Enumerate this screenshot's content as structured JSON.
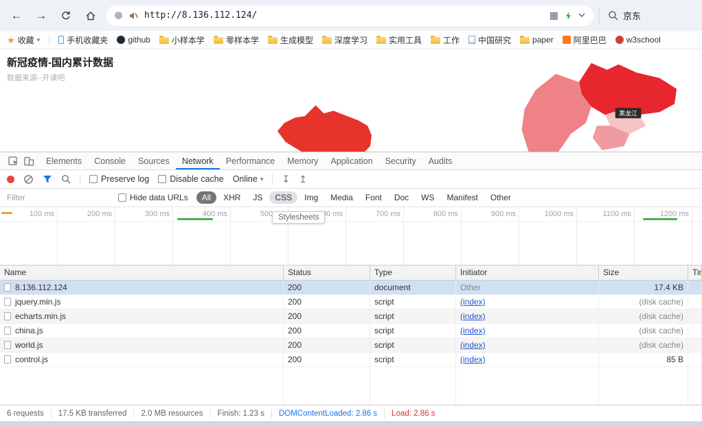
{
  "icons": {
    "back": "←",
    "forward": "→",
    "grid": "▦",
    "star": "★",
    "caret_down": "▾",
    "har_import": "↧",
    "har_export": "↥"
  },
  "browser": {
    "url": "http://8.136.112.124/",
    "search_text": "京东",
    "bookmarks": [
      {
        "label": "收藏"
      },
      {
        "label": "手机收藏夹"
      },
      {
        "label": "github"
      },
      {
        "label": "小样本学"
      },
      {
        "label": "零样本学"
      },
      {
        "label": "生成模型"
      },
      {
        "label": "深度学习"
      },
      {
        "label": "实用工具"
      },
      {
        "label": "工作"
      },
      {
        "label": "中国研究"
      },
      {
        "label": "paper"
      },
      {
        "label": "阿里巴巴"
      },
      {
        "label": "w3school"
      }
    ]
  },
  "page": {
    "title": "新冠疫情-国内累计数据",
    "subtitle": "数据来源--开课吧",
    "map_label": "黑龙江"
  },
  "devtools": {
    "tabs": [
      {
        "label": "Elements"
      },
      {
        "label": "Console"
      },
      {
        "label": "Sources"
      },
      {
        "label": "Network"
      },
      {
        "label": "Performance"
      },
      {
        "label": "Memory"
      },
      {
        "label": "Application"
      },
      {
        "label": "Security"
      },
      {
        "label": "Audits"
      }
    ],
    "toolbar": {
      "preserve_log": "Preserve log",
      "disable_cache": "Disable cache",
      "throttling": "Online"
    },
    "filter": {
      "placeholder": "Filter",
      "hide_data_urls": "Hide data URLs",
      "pills": [
        {
          "label": "All"
        },
        {
          "label": "XHR"
        },
        {
          "label": "JS"
        },
        {
          "label": "CSS"
        },
        {
          "label": "Img"
        },
        {
          "label": "Media"
        },
        {
          "label": "Font"
        },
        {
          "label": "Doc"
        },
        {
          "label": "WS"
        },
        {
          "label": "Manifest"
        },
        {
          "label": "Other"
        }
      ],
      "tooltip": "Stylesheets"
    },
    "timeline": {
      "ticks": [
        {
          "label": "100 ms"
        },
        {
          "label": "200 ms"
        },
        {
          "label": "300 ms"
        },
        {
          "label": "400 ms"
        },
        {
          "label": "500 ms"
        },
        {
          "label": "600 ms"
        },
        {
          "label": "700 ms"
        },
        {
          "label": "800 ms"
        },
        {
          "label": "900 ms"
        },
        {
          "label": "1000 ms"
        },
        {
          "label": "1100 ms"
        },
        {
          "label": "1200 ms"
        }
      ]
    },
    "table": {
      "columns": [
        {
          "label": "Name"
        },
        {
          "label": "Status"
        },
        {
          "label": "Type"
        },
        {
          "label": "Initiator"
        },
        {
          "label": "Size"
        },
        {
          "label": "Time"
        }
      ],
      "rows": [
        {
          "name": "8.136.112.124",
          "status": "200",
          "type": "document",
          "initiator": "Other",
          "size": "17.4 KB"
        },
        {
          "name": "jquery.min.js",
          "status": "200",
          "type": "script",
          "initiator": "(index)",
          "size": "(disk cache)"
        },
        {
          "name": "echarts.min.js",
          "status": "200",
          "type": "script",
          "initiator": "(index)",
          "size": "(disk cache)"
        },
        {
          "name": "china.js",
          "status": "200",
          "type": "script",
          "initiator": "(index)",
          "size": "(disk cache)"
        },
        {
          "name": "world.js",
          "status": "200",
          "type": "script",
          "initiator": "(index)",
          "size": "(disk cache)"
        },
        {
          "name": "control.js",
          "status": "200",
          "type": "script",
          "initiator": "(index)",
          "size": "85 B"
        }
      ]
    },
    "statusbar": {
      "requests": "6 requests",
      "transferred": "17.5 KB transferred",
      "resources": "2.0 MB resources",
      "finish": "Finish: 1.23 s",
      "dom_content_loaded": "DOMContentLoaded: 2.86 s",
      "load": "Load: 2.86 s"
    }
  }
}
